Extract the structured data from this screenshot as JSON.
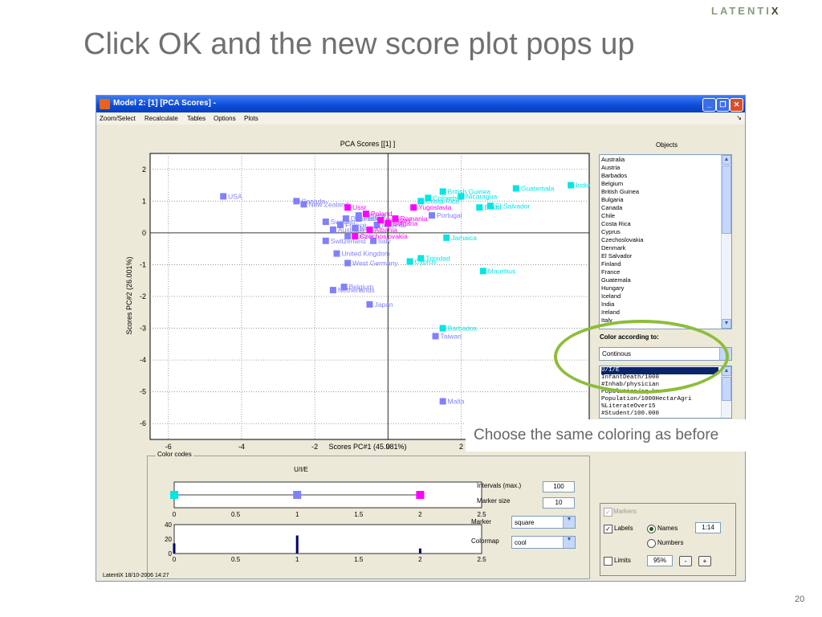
{
  "brand": {
    "text": "LATENTI",
    "x": "X"
  },
  "slide": {
    "title": "Click OK and the new score plot pops up",
    "page_number": "20",
    "callout": "Choose the same coloring as before"
  },
  "window": {
    "title": "Model 2: [1]  [PCA Scores]  -",
    "menu": [
      "Zoom/Select",
      "Recalculate",
      "Tables",
      "Options",
      "Plots"
    ],
    "footer": "LatentiX 18/10-2006  14:27"
  },
  "objects": {
    "label": "Objects",
    "items": [
      "Australia",
      "Austria",
      "Barbados",
      "Belgium",
      "British Guinea",
      "Bulgaria",
      "Canada",
      "Chile",
      "Costa Rica",
      "Cyprus",
      "Czechoslovakia",
      "Denmark",
      "El Salvador",
      "Finland",
      "France",
      "Guatemala",
      "Hungary",
      "Iceland",
      "India",
      "Ireland",
      "Italy"
    ]
  },
  "coloring": {
    "label": "Color according to:",
    "mode": "Continous",
    "variables": [
      "U/I/E",
      "InfantDeath/1000",
      "#Inhab/physician",
      "Population/sq.km",
      "Population/1000HectarAgri",
      "%LiterateOver15",
      "#Student/100.000"
    ],
    "selected_variable": "U/I/E"
  },
  "color_codes": {
    "group_label": "Color codes",
    "title": "U/I/E",
    "colorbar": {
      "ticks": [
        "0",
        "0.5",
        "1",
        "1.5",
        "2",
        "2.5"
      ],
      "markers": [
        {
          "value": 0,
          "color": "#00e5e5"
        },
        {
          "value": 1,
          "color": "#8080ff"
        },
        {
          "value": 2,
          "color": "#ff00ff"
        }
      ]
    },
    "histogram": {
      "yticks": [
        "40",
        "20",
        "0"
      ],
      "xticks": [
        "0",
        "0.5",
        "1",
        "1.5",
        "2",
        "2.5"
      ],
      "bars": [
        {
          "x": 0,
          "count": 14
        },
        {
          "x": 1,
          "count": 25
        },
        {
          "x": 2,
          "count": 7
        }
      ],
      "ymax": 40
    }
  },
  "options": {
    "intervals_label": "Intervals (max.)",
    "intervals_value": "100",
    "marker_size_label": "Marker size",
    "marker_size_value": "10",
    "marker_label": "Marker",
    "marker_value": "square",
    "colormap_label": "Colormap",
    "colormap_value": "cool"
  },
  "display": {
    "markers_label": "Markers",
    "labels_label": "Labels",
    "names_label": "Names",
    "numbers_label": "Numbers",
    "range_value": "1:14",
    "limits_label": "Limits",
    "limits_value": "95%",
    "minus": "-",
    "plus": "+"
  },
  "chart_data": {
    "type": "scatter",
    "title": "PCA Scores [[1] ]",
    "xlabel": "Scores PC#1 (45.981%)",
    "ylabel": "Scores PC#2 (26.001%)",
    "xlim": [
      -6.5,
      5.5
    ],
    "ylim": [
      -6.5,
      2.5
    ],
    "xticks": [
      -6,
      -4,
      -2,
      0,
      2
    ],
    "yticks": [
      2,
      1,
      0,
      -1,
      -2,
      -3,
      -4,
      -5,
      -6
    ],
    "grid": true,
    "colors": {
      "0": "#8080ff",
      "1": "#00e5e5",
      "2": "#ff00ff"
    },
    "points": [
      {
        "label": "USA",
        "x": -4.5,
        "y": 1.15,
        "c": 0
      },
      {
        "label": "Canada",
        "x": -2.5,
        "y": 1.0,
        "c": 0
      },
      {
        "label": "New Zealand",
        "x": -2.3,
        "y": 0.9,
        "c": 0
      },
      {
        "label": "Sweden",
        "x": -1.7,
        "y": 0.35,
        "c": 0
      },
      {
        "label": "Australia",
        "x": -1.5,
        "y": 0.1,
        "c": 0
      },
      {
        "label": "Denmark",
        "x": -1.15,
        "y": 0.45,
        "c": 0
      },
      {
        "label": "Finland",
        "x": -0.8,
        "y": 0.55,
        "c": 0
      },
      {
        "label": "Switzerland",
        "x": -1.7,
        "y": -0.25,
        "c": 0
      },
      {
        "label": "Italy",
        "x": -0.4,
        "y": -0.25,
        "c": 0
      },
      {
        "label": "United Kingdom",
        "x": -1.4,
        "y": -0.65,
        "c": 0
      },
      {
        "label": "West Germany",
        "x": -1.1,
        "y": -0.95,
        "c": 0
      },
      {
        "label": "Belgium",
        "x": -1.2,
        "y": -1.7,
        "c": 0
      },
      {
        "label": "Netherlands",
        "x": -1.5,
        "y": -1.8,
        "c": 0
      },
      {
        "label": "Japan",
        "x": -0.5,
        "y": -2.25,
        "c": 0
      },
      {
        "label": "Taiwan",
        "x": 1.3,
        "y": -3.25,
        "c": 0
      },
      {
        "label": "Malta",
        "x": 1.5,
        "y": -5.3,
        "c": 0
      },
      {
        "label": "Israel",
        "x": -0.9,
        "y": 0.15,
        "c": 0
      },
      {
        "label": "Austria",
        "x": -1.1,
        "y": -0.1,
        "c": 0
      },
      {
        "label": "France",
        "x": -1.3,
        "y": 0.25,
        "c": 0
      },
      {
        "label": "Iceland",
        "x": -0.3,
        "y": 0.25,
        "c": 0
      },
      {
        "label": "Ireland",
        "x": -0.8,
        "y": 0.45,
        "c": 0
      },
      {
        "label": "Portugal",
        "x": 1.2,
        "y": 0.55,
        "c": 0
      },
      {
        "label": "Ussr",
        "x": -1.1,
        "y": 0.8,
        "c": 2
      },
      {
        "label": "Poland",
        "x": -0.6,
        "y": 0.6,
        "c": 2
      },
      {
        "label": "Hungary",
        "x": -0.2,
        "y": 0.4,
        "c": 2
      },
      {
        "label": "Romania",
        "x": 0.2,
        "y": 0.45,
        "c": 2
      },
      {
        "label": "Bulgaria",
        "x": 0.0,
        "y": 0.3,
        "c": 2
      },
      {
        "label": "Czechoslovakia",
        "x": -0.9,
        "y": -0.1,
        "c": 2
      },
      {
        "label": "Yugoslavia",
        "x": 0.7,
        "y": 0.8,
        "c": 2
      },
      {
        "label": "Albania",
        "x": -0.5,
        "y": 0.1,
        "c": 2
      },
      {
        "label": "Guatemala",
        "x": 3.5,
        "y": 1.4,
        "c": 1
      },
      {
        "label": "India",
        "x": 5.0,
        "y": 1.5,
        "c": 1
      },
      {
        "label": "British Guinea",
        "x": 1.5,
        "y": 1.3,
        "c": 1
      },
      {
        "label": "Nicaragua",
        "x": 2.0,
        "y": 1.15,
        "c": 1
      },
      {
        "label": "Colombia",
        "x": 1.1,
        "y": 1.1,
        "c": 1
      },
      {
        "label": "Costa Rica",
        "x": 0.9,
        "y": 1.0,
        "c": 1
      },
      {
        "label": "El Salvador",
        "x": 2.8,
        "y": 0.85,
        "c": 1
      },
      {
        "label": "Brazil",
        "x": 2.5,
        "y": 0.8,
        "c": 1
      },
      {
        "label": "Jamaica",
        "x": 1.6,
        "y": -0.15,
        "c": 1
      },
      {
        "label": "Trinidad",
        "x": 0.9,
        "y": -0.8,
        "c": 1
      },
      {
        "label": "Cyprus",
        "x": 0.6,
        "y": -0.9,
        "c": 1
      },
      {
        "label": "Mauritius",
        "x": 2.6,
        "y": -1.2,
        "c": 1
      },
      {
        "label": "Barbados",
        "x": 1.5,
        "y": -3.0,
        "c": 1
      }
    ]
  }
}
